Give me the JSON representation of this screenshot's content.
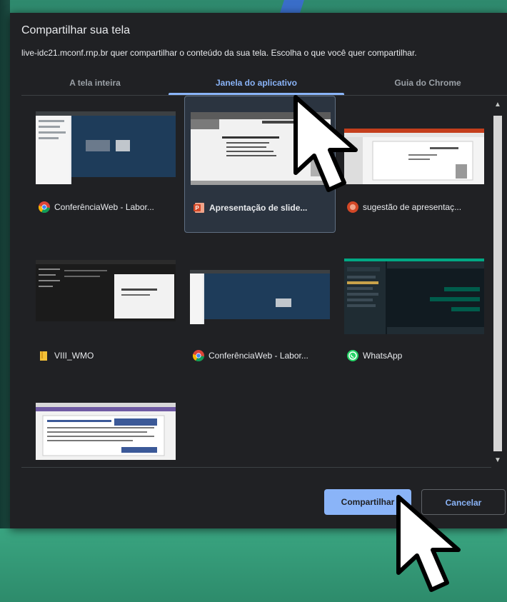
{
  "dialog": {
    "title": "Compartilhar sua tela",
    "subtitle": "live-idc21.mconf.rnp.br quer compartilhar o conteúdo da sua tela. Escolha o que você quer compartilhar."
  },
  "tabs": [
    {
      "label": "A tela inteira",
      "active": false
    },
    {
      "label": "Janela do aplicativo",
      "active": true
    },
    {
      "label": "Guia do Chrome",
      "active": false
    }
  ],
  "windows": [
    {
      "label": "ConferênciaWeb - Labor...",
      "icon": "chrome-icon",
      "selected": false
    },
    {
      "label": "Apresentação de slide...",
      "icon": "powerpoint-icon",
      "selected": true
    },
    {
      "label": "sugestão de apresentaç...",
      "icon": "powerpoint-icon",
      "selected": false
    },
    {
      "label": "VIII_WMO",
      "icon": "folder-icon",
      "selected": false
    },
    {
      "label": "ConferênciaWeb - Labor...",
      "icon": "chrome-icon",
      "selected": false
    },
    {
      "label": "WhatsApp",
      "icon": "whatsapp-icon",
      "selected": false
    },
    {
      "label": "",
      "icon": "",
      "selected": false
    }
  ],
  "buttons": {
    "share": "Compartilhar",
    "cancel": "Cancelar"
  },
  "colors": {
    "accent": "#8ab4f8",
    "dialog_bg": "#202124",
    "desktop_bg": "#3c9f80"
  }
}
